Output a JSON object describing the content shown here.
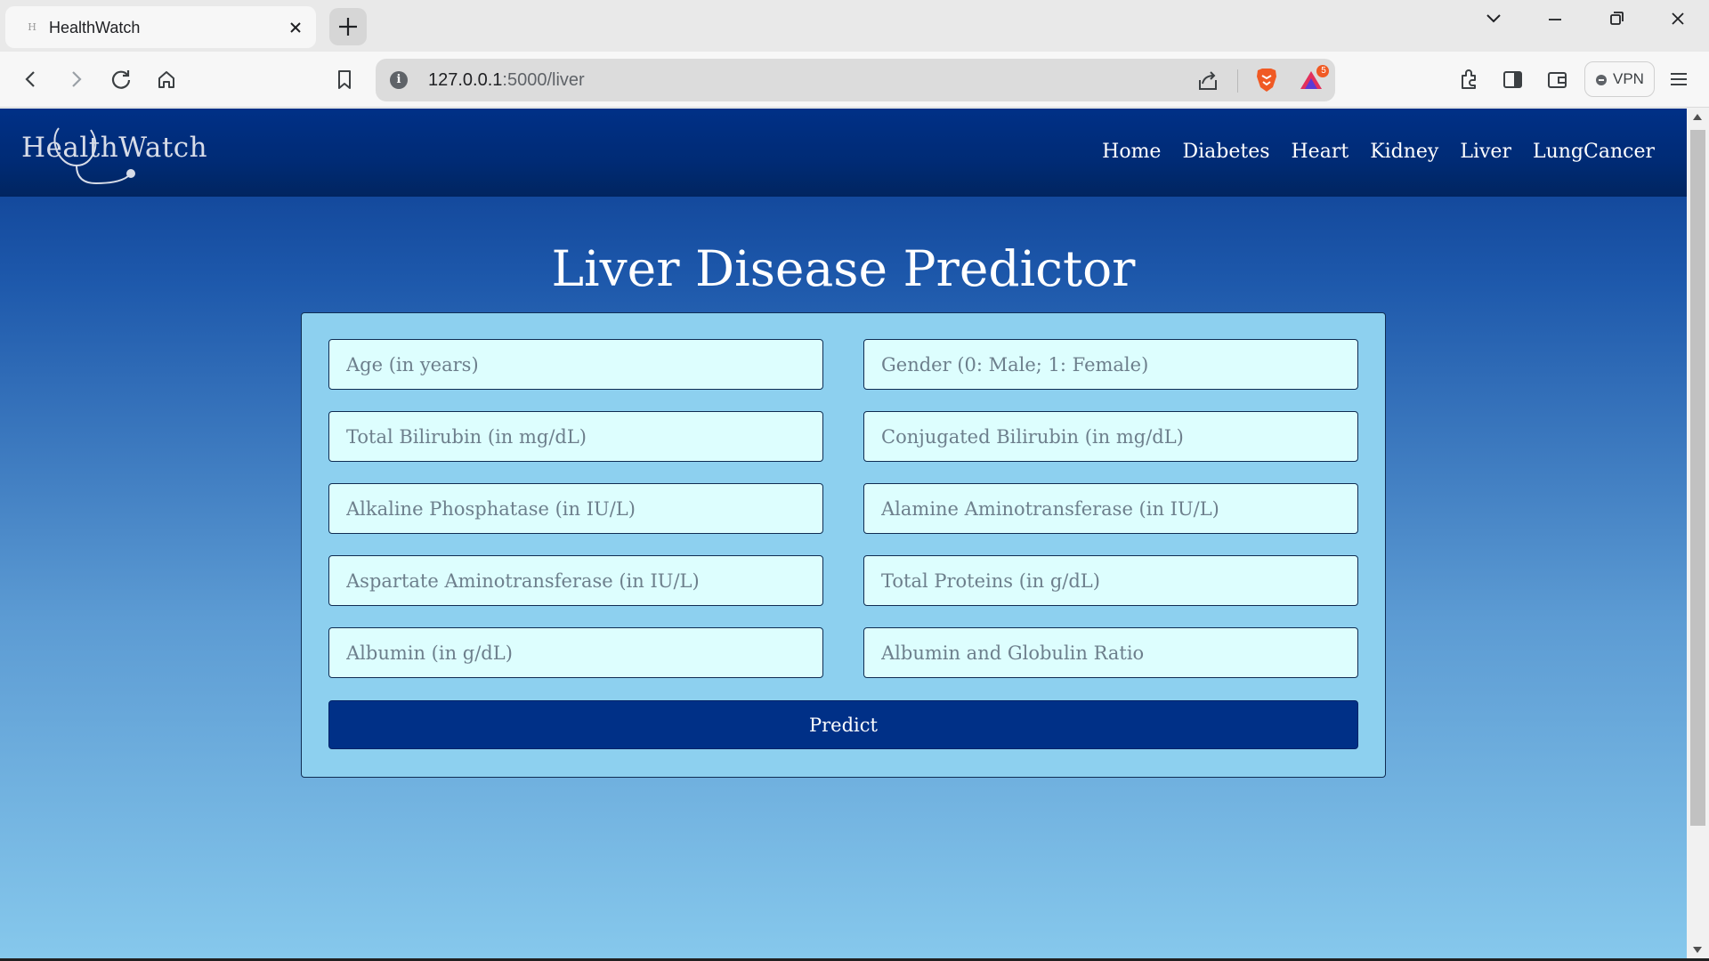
{
  "browser": {
    "tab_title": "HealthWatch",
    "tab_favicon": "H",
    "url_host": "127.0.0.1",
    "url_rest": ":5000/liver",
    "vpn_label": "VPN",
    "notification_count": "5"
  },
  "site": {
    "logo_text": "HealthWatch",
    "nav": [
      "Home",
      "Diabetes",
      "Heart",
      "Kidney",
      "Liver",
      "LungCancer"
    ]
  },
  "page": {
    "title": "Liver Disease Predictor",
    "fields": [
      "Age (in years)",
      "Gender (0: Male; 1: Female)",
      "Total Bilirubin (in mg/dL)",
      "Conjugated Bilirubin (in mg/dL)",
      "Alkaline Phosphatase (in IU/L)",
      "Alamine Aminotransferase (in IU/L)",
      "Aspartate Aminotransferase (in IU/L)",
      "Total Proteins (in g/dL)",
      "Albumin (in g/dL)",
      "Albumin and Globulin Ratio"
    ],
    "predict_label": "Predict"
  },
  "colors": {
    "nav_bg": "#003087",
    "card_bg": "#8dd0ef",
    "field_bg": "#ddfefe",
    "button_bg": "#003087",
    "brave_orange": "#f05a24"
  }
}
